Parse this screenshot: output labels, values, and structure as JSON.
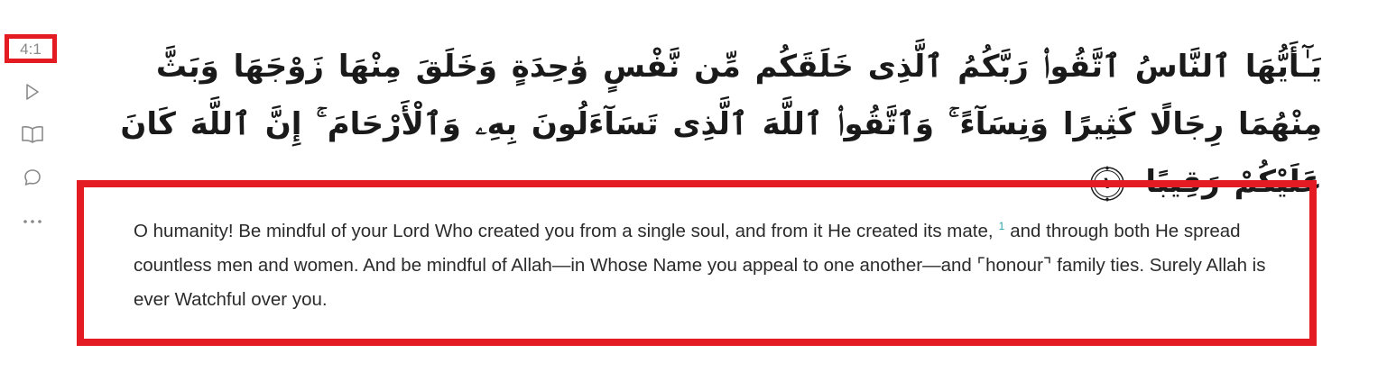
{
  "verse": {
    "key": "4:1",
    "arabic_text": "يَـٰٓأَيُّهَا ٱلنَّاسُ ٱتَّقُوا۟ رَبَّكُمُ ٱلَّذِى خَلَقَكُم مِّن نَّفْسٍ وَٰحِدَةٍ وَخَلَقَ مِنْهَا زَوْجَهَا وَبَثَّ مِنْهُمَا رِجَالًا كَثِيرًا وَنِسَآءً ۚ وَٱتَّقُوا۟ ٱللَّهَ ٱلَّذِى تَسَآءَلُونَ بِهِۦ وَٱلْأَرْحَامَ ۚ إِنَّ ٱللَّهَ كَانَ عَلَيْكُمْ رَقِيبًا",
    "end_marker_number": "١",
    "translation_part1": "O humanity! Be mindful of your Lord Who created you from a single soul, and from it He created its mate,",
    "footnote_marker": "1",
    "translation_part2": "and through both He spread countless men and women. And be mindful of Allah—in Whose Name you appeal to one another—and ⌜honour⌝ family ties. Surely Allah is ever Watchful over you."
  },
  "actions": {
    "play_icon": "play-icon",
    "tafsir_icon": "open-book-icon",
    "reflect_icon": "chat-bubble-icon",
    "more_icon": "more-horizontal-icon"
  },
  "colors": {
    "highlight_border": "#e51b24",
    "icon_gray": "#8a8a8a",
    "footnote_teal": "#2ca4ab",
    "text_dark": "#2b2b2b"
  }
}
